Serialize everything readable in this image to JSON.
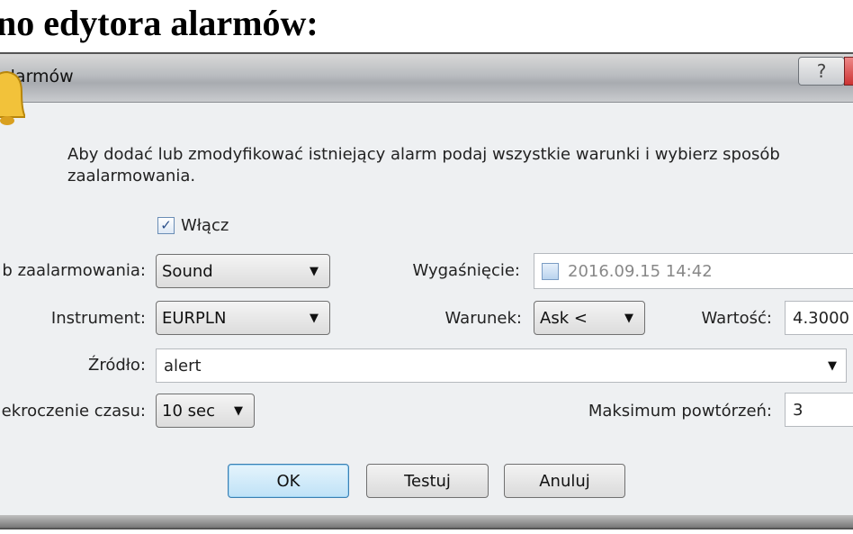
{
  "heading": "no edytora alarmów:",
  "window": {
    "title": "alarmów",
    "help_label": "?"
  },
  "description": "Aby dodać lub zmodyfikować istniejący alarm podaj wszystkie warunki i wybierz sposób zaalarmowania.",
  "enable": {
    "label": "Włącz",
    "checked": true
  },
  "alert_method": {
    "label": "b zaalarmowania:",
    "value": "Sound"
  },
  "expiry": {
    "label": "Wygaśnięcie:",
    "checked": false,
    "value": "2016.09.15 14:42"
  },
  "instrument": {
    "label": "Instrument:",
    "value": "EURPLN"
  },
  "condition": {
    "label": "Warunek:",
    "value": "Ask <"
  },
  "value": {
    "label": "Wartość:",
    "value": "4.3000"
  },
  "source": {
    "label": "Źródło:",
    "value": "alert"
  },
  "timeout": {
    "label": "ekroczenie czasu:",
    "value": "10 sec"
  },
  "max_repeats": {
    "label": "Maksimum powtórzeń:",
    "value": "3"
  },
  "buttons": {
    "ok": "OK",
    "test": "Testuj",
    "cancel": "Anuluj"
  },
  "arrow": "▼",
  "check": "✓"
}
